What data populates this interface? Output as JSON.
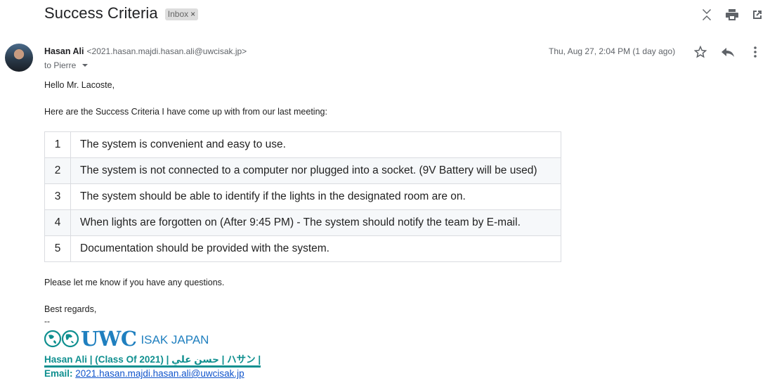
{
  "email": {
    "subject": "Success Criteria",
    "label": "Inbox",
    "sender_name": "Hasan Ali",
    "sender_email": "<2021.hasan.majdi.hasan.ali@uwcisak.jp>",
    "to": "to Pierre",
    "date": "Thu, Aug 27, 2:04 PM (1 day ago)",
    "greeting": "Hello Mr. Lacoste,",
    "intro": "Here are the Success Criteria I have come up with from our last meeting:",
    "criteria": [
      {
        "num": "1",
        "text": "The system is convenient and easy to use."
      },
      {
        "num": "2",
        "text": "The system is not connected to a computer nor plugged into a socket. (9V Battery will be used)"
      },
      {
        "num": "3",
        "text": "The system should be able to identify if the lights in the designated room are on."
      },
      {
        "num": "4",
        "text": "When lights are forgotten on (After 9:45 PM) - The system should notify the team by E-mail."
      },
      {
        "num": "5",
        "text": "Documentation should be provided with the system."
      }
    ],
    "closing": "Please let me know if you have any questions.",
    "regards": "Best regards,",
    "sig_dash": "--",
    "logo_main": "UWC",
    "logo_sub": "ISAK JAPAN",
    "sig_name": "Hasan Ali | (Class Of 2021) | حسن علي | ハサン |",
    "sig_email_label": "Email",
    "sig_email_sep": ": ",
    "sig_email": "2021.hasan.majdi.hasan.ali@uwcisak.jp"
  },
  "icons": {
    "collapse": "collapse-icon",
    "print": "print-icon",
    "open_new": "open-in-new-icon",
    "star": "star-icon",
    "reply": "reply-icon",
    "more": "more-vert-icon"
  },
  "colors": {
    "accent_link": "#1155cc",
    "signature_teal": "#0e8f8f",
    "logo_blue": "#1f7fbf"
  }
}
